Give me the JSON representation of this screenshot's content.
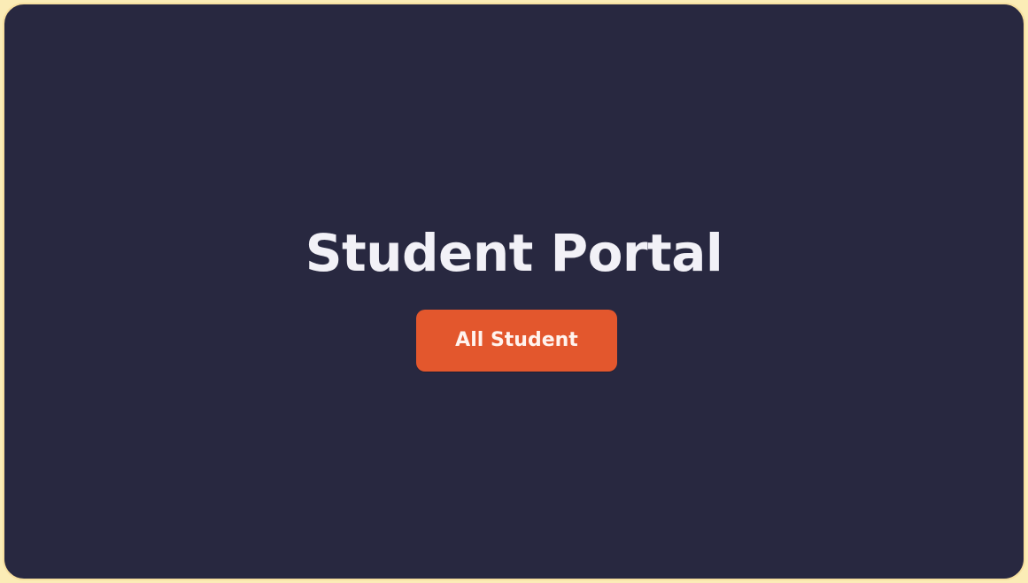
{
  "page": {
    "title": "Student Portal",
    "primary_button_label": "All Student"
  },
  "colors": {
    "background": "#282840",
    "border": "#f6dfa0",
    "title": "#f2f1f7",
    "button": "#e3572d",
    "button_text": "#fff3ee"
  }
}
